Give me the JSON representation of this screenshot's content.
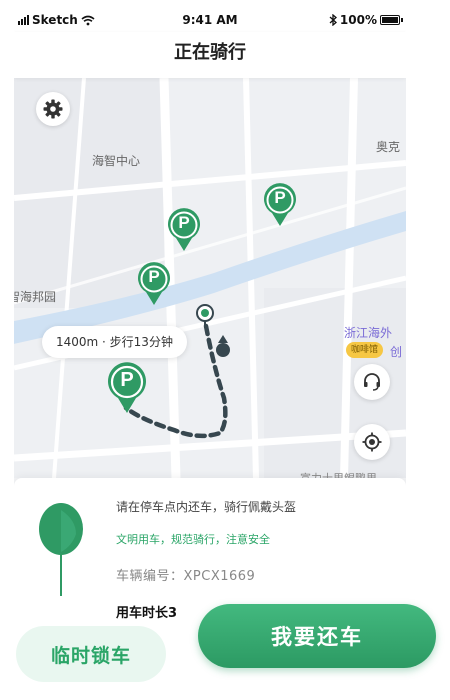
{
  "status_bar": {
    "carrier": "Sketch",
    "time": "9:41 AM",
    "battery": "100%"
  },
  "nav": {
    "title": "正在骑行"
  },
  "map": {
    "labels": {
      "haizhi_center": "海智中心",
      "haibang_garden": "智海邦园",
      "aoke": "奥克",
      "zhejiang_haiwai": "浙江海外",
      "chuang": "创",
      "bottom_road": "富力士里鲲鹏里"
    },
    "poi_badge": "咖啡馆",
    "parking_letter": "P",
    "distance_tag": "1400m · 步行13分钟",
    "icons": {
      "settings": "gear-icon",
      "service": "headset-icon",
      "locate": "locate-icon"
    },
    "colors": {
      "park": "#2f9a64",
      "route": "#37474f",
      "water": "#cfe1f3"
    }
  },
  "card": {
    "tip_main": "请在停车点内还车，骑行佩戴头盔",
    "tip_sub": "文明用车，规范骑行，注意安全",
    "vehicle_label": "车辆编号：",
    "vehicle_id": "XPCX1669",
    "duration_text": "用车时长3"
  },
  "buttons": {
    "lock": "临时锁车",
    "return": "我要还车"
  }
}
